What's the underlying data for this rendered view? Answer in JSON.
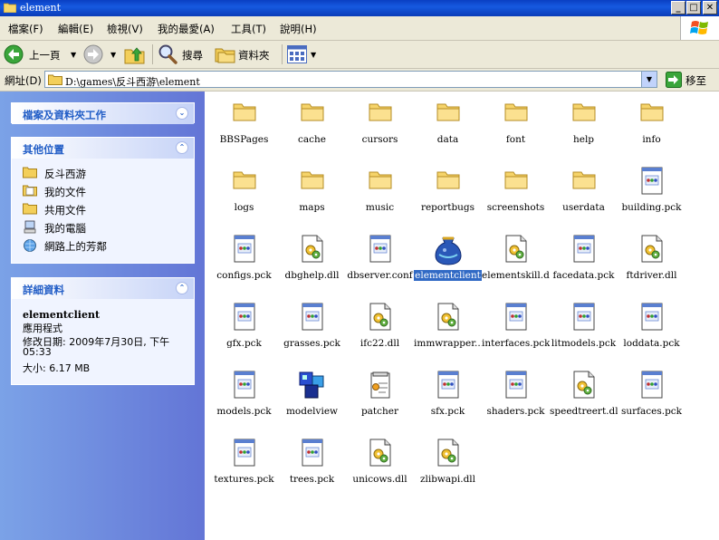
{
  "window": {
    "title": "element"
  },
  "menu": [
    "檔案(F)",
    "編輯(E)",
    "檢視(V)",
    "我的最愛(A)",
    "工具(T)",
    "說明(H)"
  ],
  "toolbar": {
    "back": "上一頁",
    "search": "搜尋",
    "folders": "資料夾"
  },
  "address": {
    "label": "網址(D)",
    "path": "D:\\games\\反斗西游\\element",
    "go": "移至"
  },
  "tasks": {
    "file_tasks_title": "檔案及資料夾工作"
  },
  "places": {
    "title": "其他位置",
    "items": [
      "反斗西游",
      "我的文件",
      "共用文件",
      "我的電腦",
      "網路上的芳鄰"
    ]
  },
  "details": {
    "title": "詳細資料",
    "name": "elementclient",
    "type": "應用程式",
    "modified_line1": "修改日期: 2009年7月30日, 下午",
    "modified_line2": "05:33",
    "size": "大小: 6.17 MB"
  },
  "files": [
    {
      "name": "BBSPages",
      "kind": "folder"
    },
    {
      "name": "cache",
      "kind": "folder"
    },
    {
      "name": "cursors",
      "kind": "folder"
    },
    {
      "name": "data",
      "kind": "folder"
    },
    {
      "name": "font",
      "kind": "folder"
    },
    {
      "name": "help",
      "kind": "folder"
    },
    {
      "name": "info",
      "kind": "folder"
    },
    {
      "name": "logs",
      "kind": "folder"
    },
    {
      "name": "maps",
      "kind": "folder"
    },
    {
      "name": "music",
      "kind": "folder"
    },
    {
      "name": "reportbugs",
      "kind": "folder"
    },
    {
      "name": "screenshots",
      "kind": "folder"
    },
    {
      "name": "userdata",
      "kind": "folder"
    },
    {
      "name": "building.pck",
      "kind": "file"
    },
    {
      "name": "configs.pck",
      "kind": "file"
    },
    {
      "name": "dbghelp.dll",
      "kind": "dll"
    },
    {
      "name": "dbserver.conf",
      "kind": "file"
    },
    {
      "name": "elementclient",
      "kind": "exe",
      "selected": true
    },
    {
      "name": "elementskill.dll",
      "kind": "dll"
    },
    {
      "name": "facedata.pck",
      "kind": "file"
    },
    {
      "name": "ftdriver.dll",
      "kind": "dll"
    },
    {
      "name": "gfx.pck",
      "kind": "file"
    },
    {
      "name": "grasses.pck",
      "kind": "file"
    },
    {
      "name": "ifc22.dll",
      "kind": "dll"
    },
    {
      "name": "immwrapper....",
      "kind": "dll"
    },
    {
      "name": "interfaces.pck",
      "kind": "file"
    },
    {
      "name": "litmodels.pck",
      "kind": "file"
    },
    {
      "name": "loddata.pck",
      "kind": "file"
    },
    {
      "name": "models.pck",
      "kind": "file"
    },
    {
      "name": "modelview",
      "kind": "app"
    },
    {
      "name": "patcher",
      "kind": "patcher"
    },
    {
      "name": "sfx.pck",
      "kind": "file"
    },
    {
      "name": "shaders.pck",
      "kind": "file"
    },
    {
      "name": "speedtreert.dll",
      "kind": "dll"
    },
    {
      "name": "surfaces.pck",
      "kind": "file"
    },
    {
      "name": "textures.pck",
      "kind": "file"
    },
    {
      "name": "trees.pck",
      "kind": "file"
    },
    {
      "name": "unicows.dll",
      "kind": "dll"
    },
    {
      "name": "zlibwapi.dll",
      "kind": "dll"
    }
  ]
}
